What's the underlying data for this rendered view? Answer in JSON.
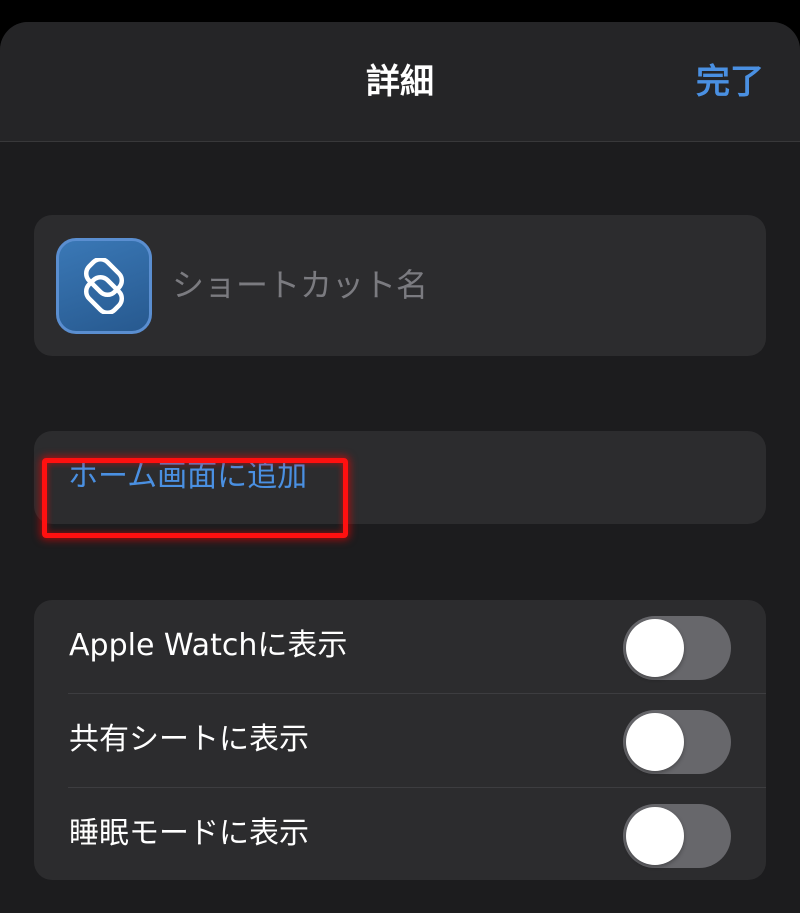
{
  "navbar": {
    "title": "詳細",
    "done_label": "完了"
  },
  "shortcut": {
    "icon": "shortcuts-app-icon",
    "name_value": "",
    "name_placeholder": "ショートカット名"
  },
  "home_screen": {
    "label": "ホーム画面に追加"
  },
  "toggles": [
    {
      "label": "Apple Watchに表示",
      "on": false
    },
    {
      "label": "共有シートに表示",
      "on": false
    },
    {
      "label": "睡眠モードに表示",
      "on": false
    }
  ],
  "colors": {
    "accent": "#4a90e2",
    "highlight": "#ff1010",
    "background": "#1c1c1e",
    "card": "#2c2c2e"
  }
}
